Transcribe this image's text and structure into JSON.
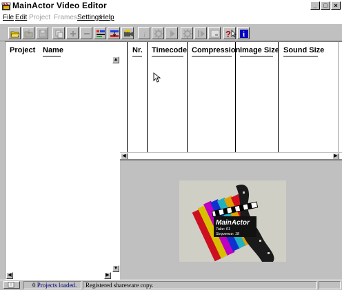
{
  "window": {
    "title": "MainActor Video Editor",
    "app_icon": "film-clapper-icon",
    "controls": [
      "minimize-icon",
      "maximize-icon",
      "close-icon"
    ]
  },
  "menu": {
    "items": [
      {
        "label": "File",
        "enabled": true
      },
      {
        "label": "Edit",
        "enabled": true
      },
      {
        "label": "Project",
        "enabled": false
      },
      {
        "label": "Frames",
        "enabled": false
      },
      {
        "label": "Settings",
        "enabled": true
      },
      {
        "label": "Help",
        "enabled": true
      }
    ]
  },
  "toolbar": {
    "buttons": [
      "open-folder-icon",
      "save-folder-icon",
      "save-disk-icon",
      "copy-icon",
      "add-icon",
      "remove-icon",
      "properties-icon",
      "cut-icon",
      "camera-icon",
      "info-icon",
      "settings-gear-icon",
      "play-icon",
      "render-gear-icon",
      "step-play-icon",
      "preview-icon",
      "help-pointer-icon",
      "about-icon"
    ]
  },
  "project_panel": {
    "columns": [
      "Project",
      "Name"
    ]
  },
  "sequence_panel": {
    "columns": [
      "Nr.",
      "Timecode",
      "Compression",
      "Image Size",
      "Sound Size"
    ]
  },
  "preview": {
    "logo_text": "MainActor",
    "take_label": "Take: 01",
    "sequence_label": "Sequence: 18"
  },
  "status_bar": {
    "projects_count": "0",
    "projects_label": "Projects loaded.",
    "message": "Registered shareware copy."
  },
  "colors": {
    "window_bg": "#c0c0c0",
    "link_blue": "#000080",
    "preview_bg": "#cfcfc6"
  }
}
